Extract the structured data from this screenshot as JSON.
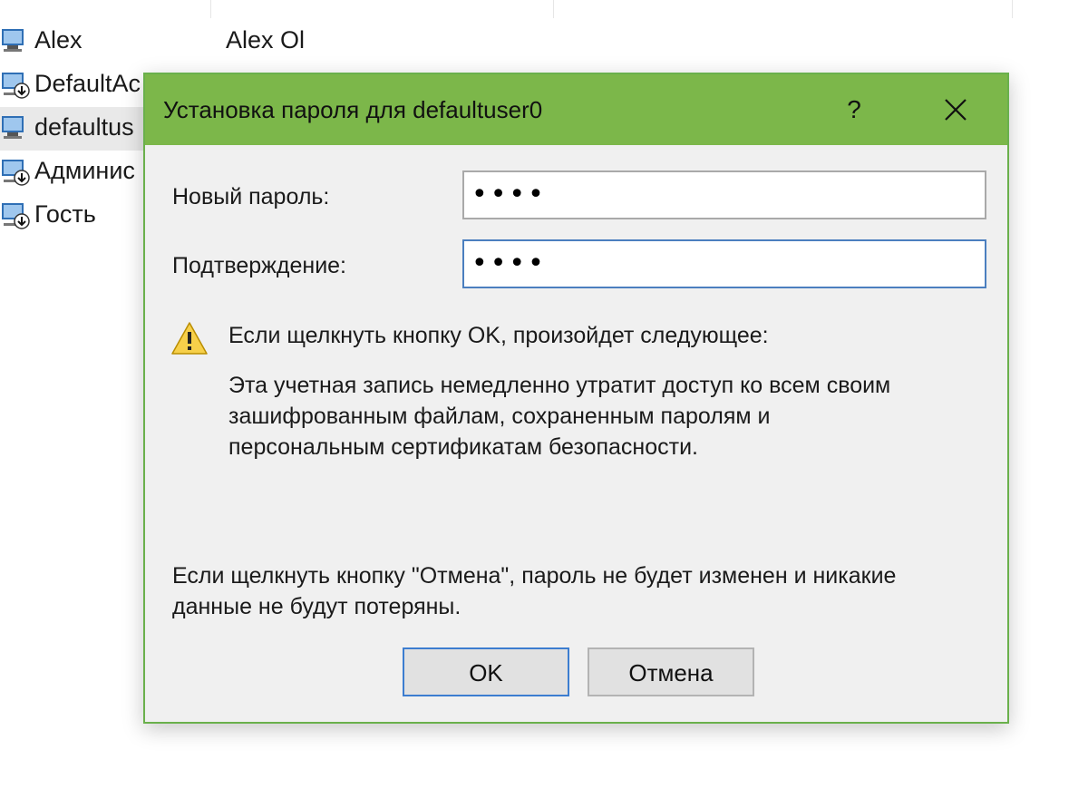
{
  "users": [
    {
      "name": "Alex",
      "fullname": "Alex Ol",
      "selected": false,
      "icon": "user-icon"
    },
    {
      "name": "DefaultAc",
      "fullname": "",
      "selected": false,
      "icon": "user-download-icon"
    },
    {
      "name": "defaultus",
      "fullname": "",
      "selected": true,
      "icon": "user-icon"
    },
    {
      "name": "Админис",
      "fullname": "",
      "selected": false,
      "icon": "user-download-icon"
    },
    {
      "name": "Гость",
      "fullname": "",
      "selected": false,
      "icon": "user-download-icon"
    }
  ],
  "dialog": {
    "title": "Установка пароля для defaultuser0",
    "help_label": "?",
    "new_password_label": "Новый пароль:",
    "new_password_value": "••••",
    "confirm_label": "Подтверждение:",
    "confirm_value": "••••",
    "warning_heading": "Если щелкнуть кнопку OK, произойдет следующее:",
    "warning_lines": [
      "Эта учетная запись немедленно утратит доступ ко всем своим",
      "зашифрованным файлам, сохраненным паролям и",
      "персональным сертификатам безопасности."
    ],
    "cancel_note_lines": [
      "Если щелкнуть кнопку \"Отмена\", пароль не будет изменен и никакие",
      "данные не будут потеряны."
    ],
    "ok_label": "OK",
    "cancel_label": "Отмена"
  },
  "colors": {
    "titlebar": "#7cb74a",
    "dialog_border": "#6ab04c",
    "dialog_bg": "#f0f0f0",
    "focus_border": "#4b7fbf"
  }
}
